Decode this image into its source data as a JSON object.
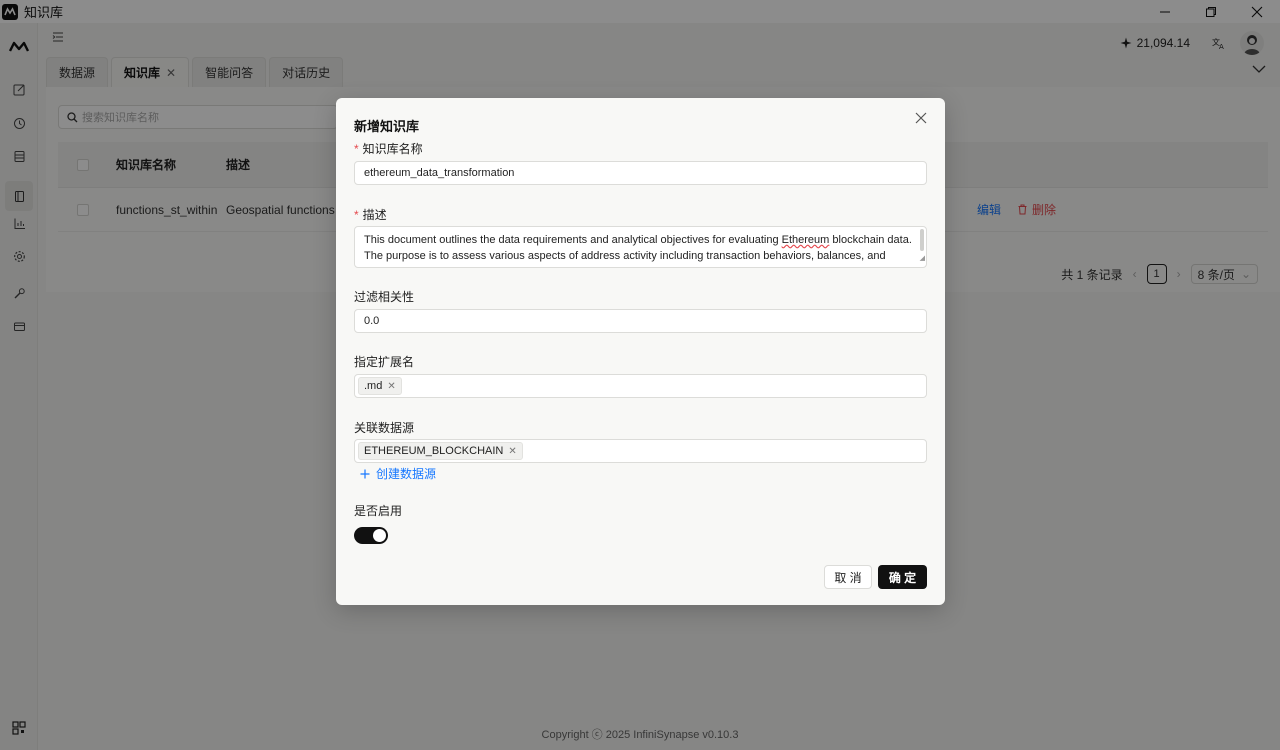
{
  "window": {
    "title": "知识库",
    "controls": [
      "minimize-icon",
      "restore-icon",
      "close-icon"
    ]
  },
  "sidebar": {
    "icons": [
      "logo-icon",
      "edit-icon",
      "history-icon",
      "database-icon",
      "book-icon",
      "chart-icon",
      "gear-icon",
      "wrench-icon",
      "card-icon",
      "qr-code-icon"
    ]
  },
  "topbar": {
    "credits": "21,094.14",
    "translate_icon": "translate-icon"
  },
  "tabs": [
    {
      "label": "数据源"
    },
    {
      "label": "知识库",
      "closable": true
    },
    {
      "label": "智能问答"
    },
    {
      "label": "对话历史"
    }
  ],
  "list": {
    "search_placeholder": "搜索知识库名称",
    "columns": [
      "知识库名称",
      "描述"
    ],
    "rows": [
      {
        "name": "functions_st_within",
        "description": "Geospatial functions",
        "edit_label": "编辑",
        "delete_label": "删除"
      }
    ],
    "pagination": {
      "total": "共 1 条记录",
      "current_page": "1",
      "page_size": "8 条/页"
    }
  },
  "footer": {
    "copyright": "Copyright ⓒ 2025 InfiniSynapse v0.10.3"
  },
  "modal": {
    "title": "新增知识库",
    "name_label": "知识库名称",
    "name_value": "ethereum_data_transformation",
    "desc_label": "描述",
    "desc_before": "This document outlines the data requirements and analytical objectives for evaluating ",
    "desc_misspelled": "Ethereum",
    "desc_after": " blockchain data. The purpose is to assess various aspects of address activity including transaction behaviors, balances, and contract",
    "filter_label": "过滤相关性",
    "filter_value": "0.0",
    "ext_label": "指定扩展名",
    "ext_tags": [
      ".md"
    ],
    "datasource_label": "关联数据源",
    "datasource_tags": [
      "ETHEREUM_BLOCKCHAIN"
    ],
    "create_datasource": "创建数据源",
    "enable_label": "是否启用",
    "enabled": true,
    "cancel_label": "取 消",
    "ok_label": "确 定"
  }
}
